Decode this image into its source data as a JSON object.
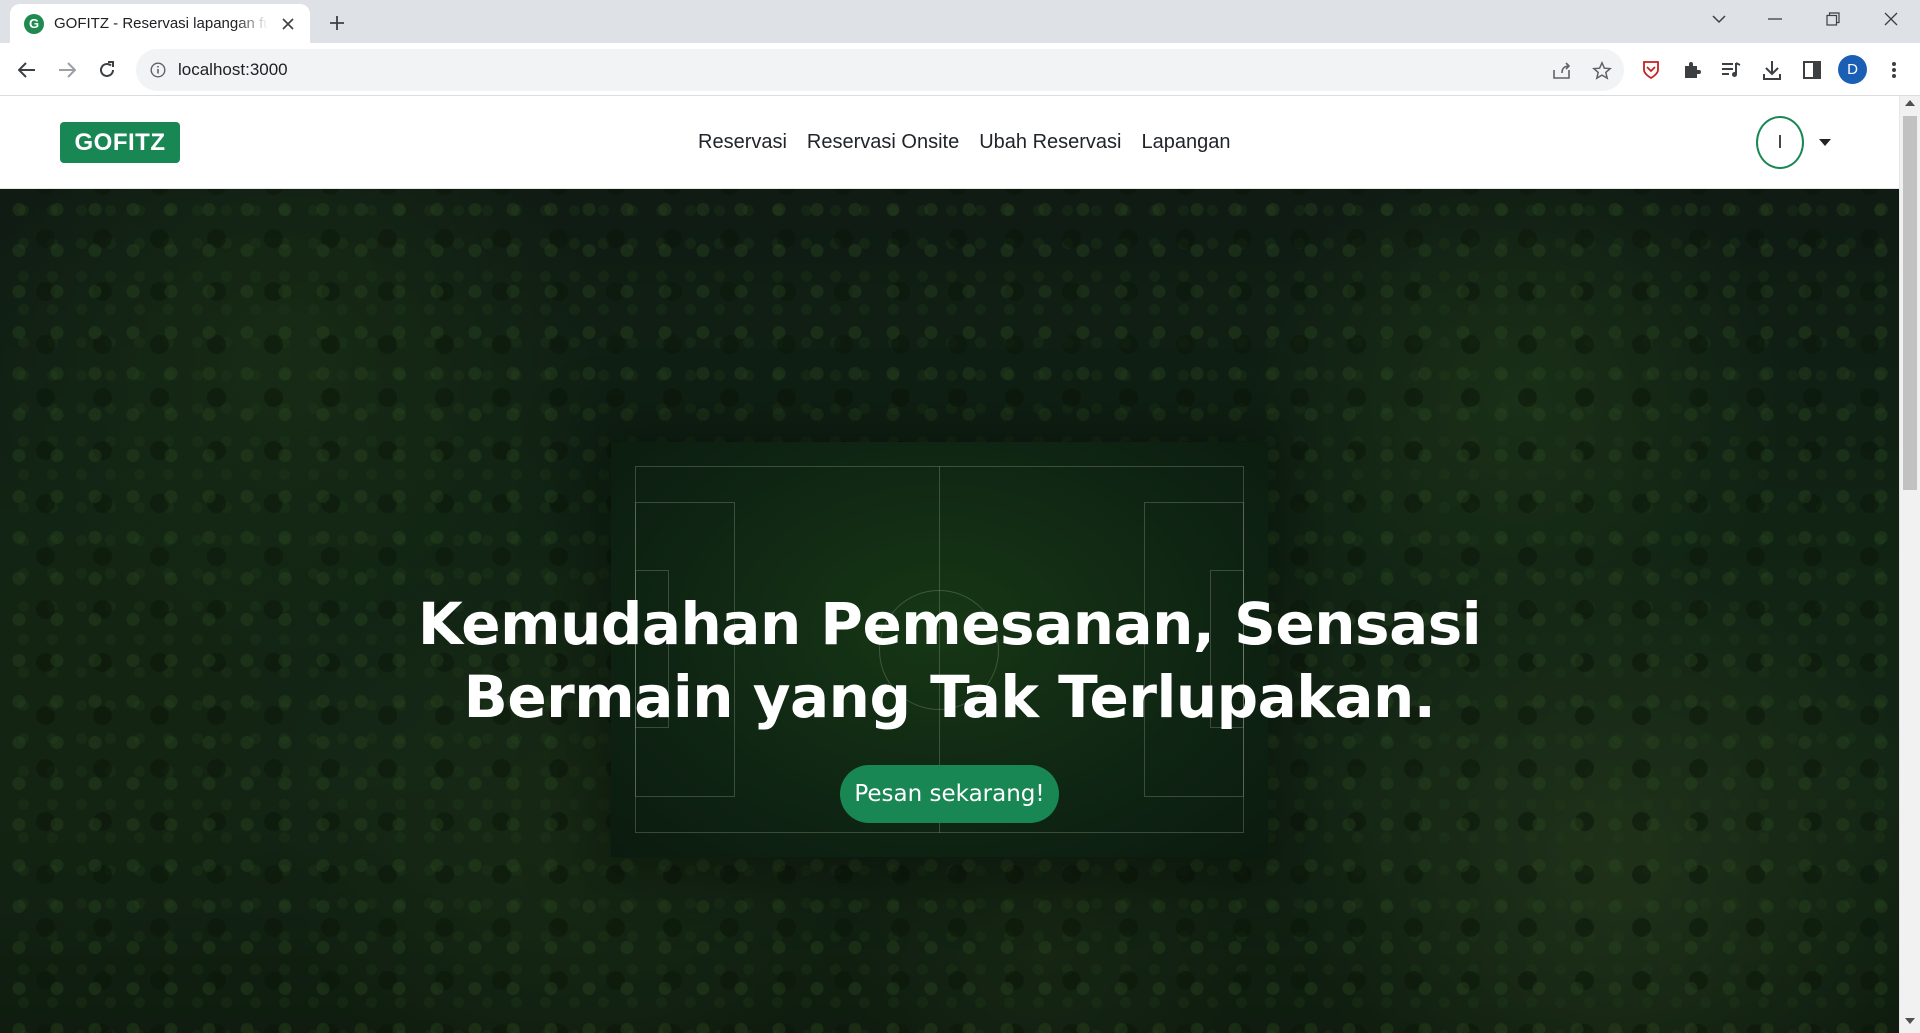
{
  "browser": {
    "tab_title": "GOFITZ - Reservasi lapangan futsal",
    "tab_favicon_letter": "G",
    "url": "localhost:3000",
    "profile_initial": "D",
    "icons": {
      "back": "arrow-left-icon",
      "forward": "arrow-right-icon",
      "reload": "reload-icon",
      "info": "info-icon",
      "share": "share-icon",
      "bookmark": "star-icon",
      "extension_shield": "shield-icon",
      "extensions": "puzzle-icon",
      "reading_list": "playlist-icon",
      "downloads": "download-icon",
      "side_panel": "side-panel-icon",
      "menu": "kebab-menu-icon"
    }
  },
  "navbar": {
    "brand": "GOFITZ",
    "links": [
      {
        "label": "Reservasi"
      },
      {
        "label": "Reservasi Onsite"
      },
      {
        "label": "Ubah Reservasi"
      },
      {
        "label": "Lapangan"
      }
    ],
    "avatar_initial": "I"
  },
  "hero": {
    "title_line1": "Kemudahan Pemesanan, Sensasi",
    "title_line2": "Bermain yang Tak Terlupakan.",
    "cta_label": "Pesan sekarang!"
  },
  "colors": {
    "brand_green": "#198754",
    "tabstrip_bg": "#dee1e6",
    "omnibox_bg": "#f1f3f4"
  }
}
